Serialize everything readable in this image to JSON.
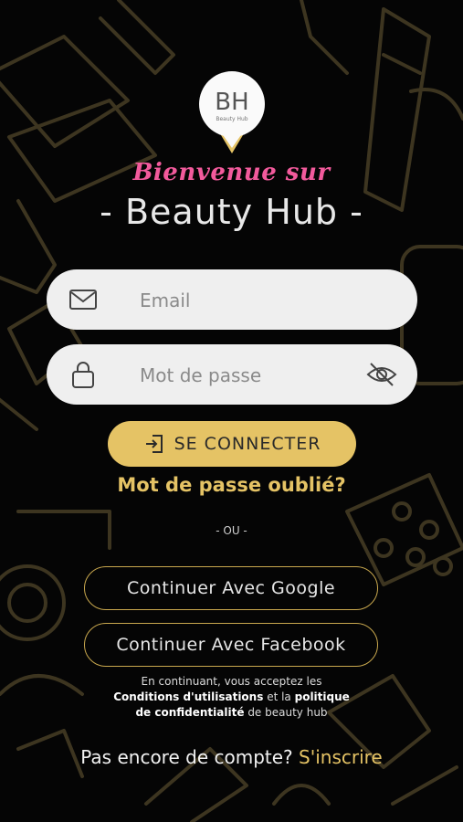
{
  "header": {
    "logo_monogram": "BH",
    "logo_caption": "Beauty Hub",
    "welcome": "Bienvenue sur",
    "title": "- Beauty Hub -"
  },
  "form": {
    "email_placeholder": "Email",
    "password_placeholder": "Mot de passe",
    "email_icon": "envelope-icon",
    "password_icon": "lock-icon",
    "visibility_icon": "eye-slash-icon",
    "login_label": "SE CONNECTER",
    "login_icon": "login-arrow-icon",
    "forgot_label": "Mot de passe oublié?"
  },
  "divider": "- OU -",
  "social": {
    "google_label": "Continuer Avec Google",
    "facebook_label": "Continuer Avec Facebook"
  },
  "terms": {
    "line1": "En continuant, vous acceptez les",
    "conditions": "Conditions d'utilisations",
    "and": "et la",
    "politique": "politique",
    "confidentialite": "de confidentialité",
    "suffix": "de beauty hub"
  },
  "footer": {
    "prompt": "Pas encore de compte?",
    "signup_label": "S'inscrire"
  },
  "colors": {
    "background": "#050505",
    "accent_gold": "#e5c365",
    "welcome_pink": "#f25a9c",
    "field_bg": "#efefef"
  }
}
